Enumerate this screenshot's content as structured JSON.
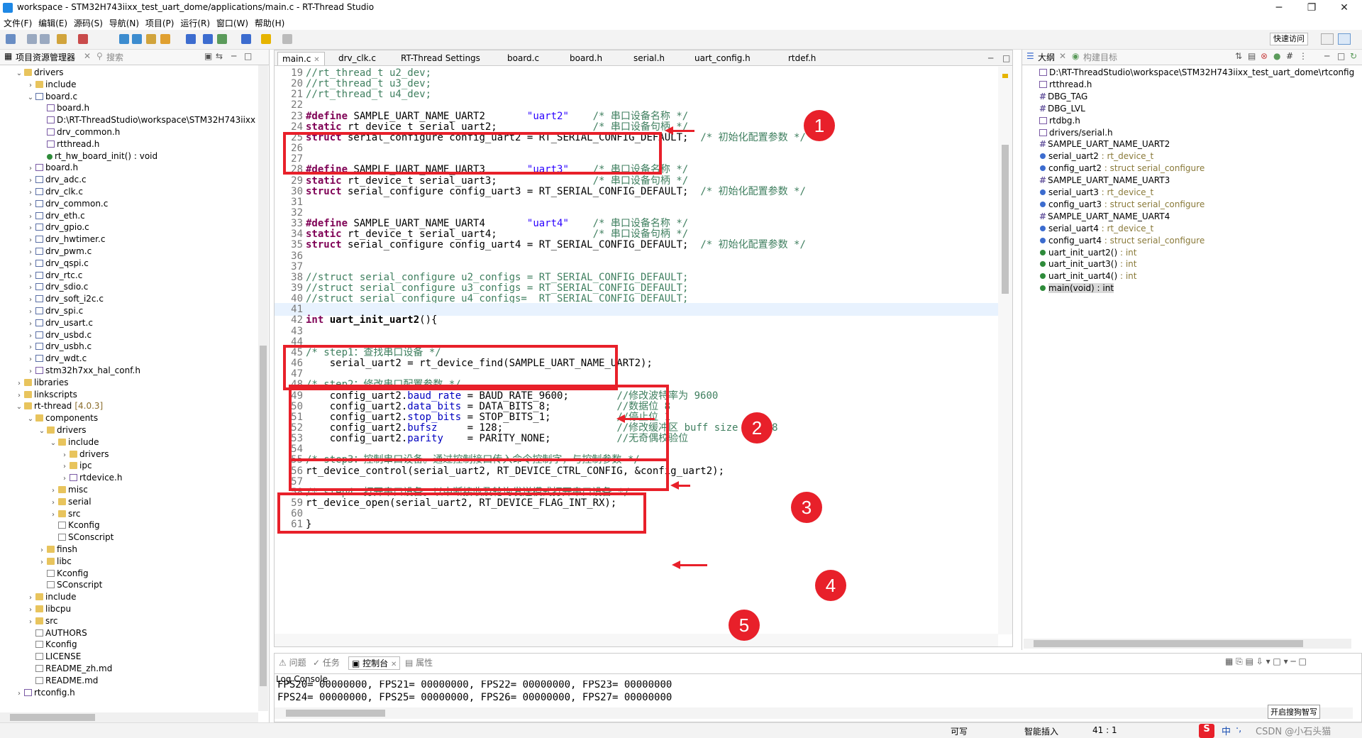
{
  "window": {
    "title": "workspace - STM32H743iixx_test_uart_dome/applications/main.c - RT-Thread Studio",
    "minimize": "─",
    "restore": "❐",
    "close": "✕"
  },
  "menubar": [
    "文件(F)",
    "编辑(E)",
    "源码(S)",
    "导航(N)",
    "项目(P)",
    "运行(R)",
    "窗口(W)",
    "帮助(H)"
  ],
  "toolbar": {
    "quick_access": "快速访问"
  },
  "project_explorer": {
    "tab_label": "项目资源管理器",
    "search_tab": "搜索",
    "tree": [
      {
        "depth": 1,
        "arrow": "v",
        "icon": "folder",
        "label": "drivers",
        "extra": ""
      },
      {
        "depth": 2,
        "arrow": ">",
        "icon": "folder",
        "label": "include",
        "extra": ""
      },
      {
        "depth": 2,
        "arrow": "v",
        "icon": "cfile",
        "label": "board.c",
        "extra": ""
      },
      {
        "depth": 3,
        "arrow": "",
        "icon": "hfile",
        "label": "board.h",
        "extra": ""
      },
      {
        "depth": 3,
        "arrow": "",
        "icon": "hfile",
        "label": "D:\\RT-ThreadStudio\\workspace\\STM32H743iixx",
        "extra": ""
      },
      {
        "depth": 3,
        "arrow": "",
        "icon": "hfile",
        "label": "drv_common.h",
        "extra": ""
      },
      {
        "depth": 3,
        "arrow": "",
        "icon": "hfile",
        "label": "rtthread.h",
        "extra": ""
      },
      {
        "depth": 3,
        "arrow": "",
        "icon": "fn",
        "label": "rt_hw_board_init() : void",
        "extra": ""
      },
      {
        "depth": 2,
        "arrow": ">",
        "icon": "hfile",
        "label": "board.h",
        "extra": ""
      },
      {
        "depth": 2,
        "arrow": ">",
        "icon": "cfile",
        "label": "drv_adc.c",
        "extra": ""
      },
      {
        "depth": 2,
        "arrow": ">",
        "icon": "cfile",
        "label": "drv_clk.c",
        "extra": ""
      },
      {
        "depth": 2,
        "arrow": ">",
        "icon": "cfile",
        "label": "drv_common.c",
        "extra": ""
      },
      {
        "depth": 2,
        "arrow": ">",
        "icon": "cfile",
        "label": "drv_eth.c",
        "extra": ""
      },
      {
        "depth": 2,
        "arrow": ">",
        "icon": "cfile",
        "label": "drv_gpio.c",
        "extra": ""
      },
      {
        "depth": 2,
        "arrow": ">",
        "icon": "cfile",
        "label": "drv_hwtimer.c",
        "extra": ""
      },
      {
        "depth": 2,
        "arrow": ">",
        "icon": "cfile",
        "label": "drv_pwm.c",
        "extra": ""
      },
      {
        "depth": 2,
        "arrow": ">",
        "icon": "cfile",
        "label": "drv_qspi.c",
        "extra": ""
      },
      {
        "depth": 2,
        "arrow": ">",
        "icon": "cfile",
        "label": "drv_rtc.c",
        "extra": ""
      },
      {
        "depth": 2,
        "arrow": ">",
        "icon": "cfile",
        "label": "drv_sdio.c",
        "extra": ""
      },
      {
        "depth": 2,
        "arrow": ">",
        "icon": "cfile",
        "label": "drv_soft_i2c.c",
        "extra": ""
      },
      {
        "depth": 2,
        "arrow": ">",
        "icon": "cfile",
        "label": "drv_spi.c",
        "extra": ""
      },
      {
        "depth": 2,
        "arrow": ">",
        "icon": "cfile",
        "label": "drv_usart.c",
        "extra": ""
      },
      {
        "depth": 2,
        "arrow": ">",
        "icon": "cfile",
        "label": "drv_usbd.c",
        "extra": ""
      },
      {
        "depth": 2,
        "arrow": ">",
        "icon": "cfile",
        "label": "drv_usbh.c",
        "extra": ""
      },
      {
        "depth": 2,
        "arrow": ">",
        "icon": "cfile",
        "label": "drv_wdt.c",
        "extra": ""
      },
      {
        "depth": 2,
        "arrow": ">",
        "icon": "hfile",
        "label": "stm32h7xx_hal_conf.h",
        "extra": ""
      },
      {
        "depth": 1,
        "arrow": ">",
        "icon": "folder",
        "label": "libraries",
        "extra": ""
      },
      {
        "depth": 1,
        "arrow": ">",
        "icon": "folder",
        "label": "linkscripts",
        "extra": ""
      },
      {
        "depth": 1,
        "arrow": "v",
        "icon": "folder",
        "label": "rt-thread",
        "extra": "[4.0.3]"
      },
      {
        "depth": 2,
        "arrow": "v",
        "icon": "folder",
        "label": "components",
        "extra": ""
      },
      {
        "depth": 3,
        "arrow": "v",
        "icon": "folder",
        "label": "drivers",
        "extra": ""
      },
      {
        "depth": 4,
        "arrow": "v",
        "icon": "folder",
        "label": "include",
        "extra": ""
      },
      {
        "depth": 5,
        "arrow": ">",
        "icon": "folder",
        "label": "drivers",
        "extra": ""
      },
      {
        "depth": 5,
        "arrow": ">",
        "icon": "folder",
        "label": "ipc",
        "extra": ""
      },
      {
        "depth": 5,
        "arrow": ">",
        "icon": "hfile",
        "label": "rtdevice.h",
        "extra": ""
      },
      {
        "depth": 4,
        "arrow": ">",
        "icon": "folder",
        "label": "misc",
        "extra": ""
      },
      {
        "depth": 4,
        "arrow": ">",
        "icon": "folder",
        "label": "serial",
        "extra": ""
      },
      {
        "depth": 4,
        "arrow": ">",
        "icon": "folder",
        "label": "src",
        "extra": ""
      },
      {
        "depth": 4,
        "arrow": "",
        "icon": "gen",
        "label": "Kconfig",
        "extra": ""
      },
      {
        "depth": 4,
        "arrow": "",
        "icon": "gen",
        "label": "SConscript",
        "extra": ""
      },
      {
        "depth": 3,
        "arrow": ">",
        "icon": "folder",
        "label": "finsh",
        "extra": ""
      },
      {
        "depth": 3,
        "arrow": ">",
        "icon": "folder",
        "label": "libc",
        "extra": ""
      },
      {
        "depth": 3,
        "arrow": "",
        "icon": "gen",
        "label": "Kconfig",
        "extra": ""
      },
      {
        "depth": 3,
        "arrow": "",
        "icon": "gen",
        "label": "SConscript",
        "extra": ""
      },
      {
        "depth": 2,
        "arrow": ">",
        "icon": "folder",
        "label": "include",
        "extra": ""
      },
      {
        "depth": 2,
        "arrow": ">",
        "icon": "folder",
        "label": "libcpu",
        "extra": ""
      },
      {
        "depth": 2,
        "arrow": ">",
        "icon": "folder",
        "label": "src",
        "extra": ""
      },
      {
        "depth": 2,
        "arrow": "",
        "icon": "gen",
        "label": "AUTHORS",
        "extra": ""
      },
      {
        "depth": 2,
        "arrow": "",
        "icon": "gen",
        "label": "Kconfig",
        "extra": ""
      },
      {
        "depth": 2,
        "arrow": "",
        "icon": "gen",
        "label": "LICENSE",
        "extra": ""
      },
      {
        "depth": 2,
        "arrow": "",
        "icon": "gen",
        "label": "README_zh.md",
        "extra": ""
      },
      {
        "depth": 2,
        "arrow": "",
        "icon": "gen",
        "label": "README.md",
        "extra": ""
      },
      {
        "depth": 1,
        "arrow": ">",
        "icon": "hfile",
        "label": "rtconfig.h",
        "extra": ""
      }
    ]
  },
  "editor": {
    "tabs": [
      "main.c",
      "drv_clk.c",
      "RT-Thread Settings",
      "board.c",
      "board.h",
      "serial.h",
      "uart_config.h",
      "rtdef.h"
    ],
    "active_tab": 0,
    "lines": [
      {
        "n": "19",
        "html": "<span class=\"cm\">//rt_thread_t u2_dev;</span>"
      },
      {
        "n": "20",
        "html": "<span class=\"cm\">//rt_thread_t u3_dev;</span>"
      },
      {
        "n": "21",
        "html": "<span class=\"cm\">//rt_thread_t u4_dev;</span>"
      },
      {
        "n": "22",
        "html": ""
      },
      {
        "n": "23",
        "html": "<span class=\"kw\">#define</span> SAMPLE_UART_NAME_UART2       <span class=\"st\">\"uart2\"</span>    <span class=\"cm\">/* 串口设备名称 */</span>"
      },
      {
        "n": "24",
        "html": "<span class=\"kw\">static</span> rt_device_t serial_uart2;                <span class=\"cm\">/* 串口设备句柄 */</span>"
      },
      {
        "n": "25",
        "html": "<span class=\"kw\">struct</span> serial_configure config_uart2 = RT_SERIAL_CONFIG_DEFAULT;  <span class=\"cm\">/* 初始化配置参数 */</span>"
      },
      {
        "n": "26",
        "html": ""
      },
      {
        "n": "27",
        "html": ""
      },
      {
        "n": "28",
        "html": "<span class=\"kw\">#define</span> SAMPLE_UART_NAME_UART3       <span class=\"st\">\"uart3\"</span>    <span class=\"cm\">/* 串口设备名称 */</span>"
      },
      {
        "n": "29",
        "html": "<span class=\"kw\">static</span> rt_device_t serial_uart3;                <span class=\"cm\">/* 串口设备句柄 */</span>"
      },
      {
        "n": "30",
        "html": "<span class=\"kw\">struct</span> serial_configure config_uart3 = RT_SERIAL_CONFIG_DEFAULT;  <span class=\"cm\">/* 初始化配置参数 */</span>"
      },
      {
        "n": "31",
        "html": ""
      },
      {
        "n": "32",
        "html": ""
      },
      {
        "n": "33",
        "html": "<span class=\"kw\">#define</span> SAMPLE_UART_NAME_UART4       <span class=\"st\">\"uart4\"</span>    <span class=\"cm\">/* 串口设备名称 */</span>"
      },
      {
        "n": "34",
        "html": "<span class=\"kw\">static</span> rt_device_t serial_uart4;                <span class=\"cm\">/* 串口设备句柄 */</span>"
      },
      {
        "n": "35",
        "html": "<span class=\"kw\">struct</span> serial_configure config_uart4 = RT_SERIAL_CONFIG_DEFAULT;  <span class=\"cm\">/* 初始化配置参数 */</span>"
      },
      {
        "n": "36",
        "html": ""
      },
      {
        "n": "37",
        "html": ""
      },
      {
        "n": "38",
        "html": "<span class=\"cm\">//struct serial_configure u2_configs = RT_SERIAL_CONFIG_DEFAULT;</span>"
      },
      {
        "n": "39",
        "html": "<span class=\"cm\">//struct serial_configure u3_configs = RT_SERIAL_CONFIG_DEFAULT;</span>"
      },
      {
        "n": "40",
        "html": "<span class=\"cm\">//struct serial_configure u4_configs=  RT_SERIAL_CONFIG_DEFAULT;</span>"
      },
      {
        "n": "41",
        "html": ""
      },
      {
        "n": "42",
        "html": "<span class=\"kw\">int</span> <b>uart_init_uart2</b>(){"
      },
      {
        "n": "43",
        "html": ""
      },
      {
        "n": "44",
        "html": ""
      },
      {
        "n": "45",
        "html": "<span class=\"cm\">/* step1：查找串口设备 */</span>"
      },
      {
        "n": "46",
        "html": "    serial_uart2 = rt_device_find(SAMPLE_UART_NAME_UART2);"
      },
      {
        "n": "47",
        "html": ""
      },
      {
        "n": "48",
        "html": "<span class=\"cm\">/* step2：修改串口配置参数 */</span>"
      },
      {
        "n": "49",
        "html": "    config_uart2.<span class=\"fl\">baud_rate</span> = BAUD_RATE_9600;        <span class=\"cm\">//修改波特率为 9600</span>"
      },
      {
        "n": "50",
        "html": "    config_uart2.<span class=\"fl\">data_bits</span> = DATA_BITS_8;           <span class=\"cm\">//数据位 8</span>"
      },
      {
        "n": "51",
        "html": "    config_uart2.<span class=\"fl\">stop_bits</span> = STOP_BITS_1;           <span class=\"cm\">//停止位 1</span>"
      },
      {
        "n": "52",
        "html": "    config_uart2.<span class=\"fl\">bufsz</span>     = 128;                   <span class=\"cm\">//修改缓冲区 buff size 为 128</span>"
      },
      {
        "n": "53",
        "html": "    config_uart2.<span class=\"fl\">parity</span>    = PARITY_NONE;           <span class=\"cm\">//无奇偶校验位</span>"
      },
      {
        "n": "54",
        "html": ""
      },
      {
        "n": "55",
        "html": "<span class=\"cm\">/* step3：控制串口设备。通过控制接口传入命令控制字，与控制参数 */</span>"
      },
      {
        "n": "56",
        "html": "rt_device_control(serial_uart2, RT_DEVICE_CTRL_CONFIG, &amp;config_uart2);"
      },
      {
        "n": "57",
        "html": ""
      },
      {
        "n": "58",
        "html": "<span class=\"cm\">/* step4：打开串口设备。以中断接收及轮询发送模式打开串口设备 */</span>"
      },
      {
        "n": "59",
        "html": "rt_device_open(serial_uart2, RT_DEVICE_FLAG_INT_RX);"
      },
      {
        "n": "60",
        "html": ""
      },
      {
        "n": "61",
        "html": "}"
      }
    ],
    "annotations": [
      "1",
      "2",
      "3",
      "4",
      "5"
    ]
  },
  "outline": {
    "tab_label": "大纲",
    "build_tab": "构建目标",
    "items": [
      {
        "kind": "hfile",
        "name": "D:\\RT-ThreadStudio\\workspace\\STM32H743iixx_test_uart_dome\\rtconfig",
        "type": ""
      },
      {
        "kind": "hfile",
        "name": "rtthread.h",
        "type": ""
      },
      {
        "kind": "hash",
        "name": "DBG_TAG",
        "type": ""
      },
      {
        "kind": "hash",
        "name": "DBG_LVL",
        "type": ""
      },
      {
        "kind": "hfile",
        "name": "rtdbg.h",
        "type": ""
      },
      {
        "kind": "hfile",
        "name": "drivers/serial.h",
        "type": ""
      },
      {
        "kind": "hash",
        "name": "SAMPLE_UART_NAME_UART2",
        "type": ""
      },
      {
        "kind": "svar",
        "name": "serial_uart2",
        "type": " : rt_device_t"
      },
      {
        "kind": "var",
        "name": "config_uart2",
        "type": " : struct serial_configure"
      },
      {
        "kind": "hash",
        "name": "SAMPLE_UART_NAME_UART3",
        "type": ""
      },
      {
        "kind": "svar",
        "name": "serial_uart3",
        "type": " : rt_device_t"
      },
      {
        "kind": "var",
        "name": "config_uart3",
        "type": " : struct serial_configure"
      },
      {
        "kind": "hash",
        "name": "SAMPLE_UART_NAME_UART4",
        "type": ""
      },
      {
        "kind": "svar",
        "name": "serial_uart4",
        "type": " : rt_device_t"
      },
      {
        "kind": "var",
        "name": "config_uart4",
        "type": " : struct serial_configure"
      },
      {
        "kind": "fn",
        "name": "uart_init_uart2()",
        "type": " : int"
      },
      {
        "kind": "fn",
        "name": "uart_init_uart3()",
        "type": " : int"
      },
      {
        "kind": "fn",
        "name": "uart_init_uart4()",
        "type": " : int"
      },
      {
        "kind": "fnsel",
        "name": "main(void) : int",
        "type": ""
      }
    ]
  },
  "console": {
    "tabs": [
      "问题",
      "任务",
      "控制台",
      "属性"
    ],
    "active": 2,
    "title": "Log Console",
    "lines": [
      "FPS20= 00000000, FPS21= 00000000, FPS22= 00000000, FPS23= 00000000",
      "FPS24= 00000000, FPS25= 00000000, FPS26= 00000000, FPS27= 00000000"
    ],
    "ime_tip": "开启搜狗智写"
  },
  "statusbar": {
    "writable": "可写",
    "insert_mode": "智能插入",
    "position": "41 : 1",
    "ime": "中",
    "watermark": "CSDN @小石头猫"
  },
  "colors": {
    "annotation": "#e8202a",
    "keyword": "#7f0055",
    "comment": "#3f7f5f",
    "string": "#2a00ff",
    "field": "#0000c0"
  }
}
